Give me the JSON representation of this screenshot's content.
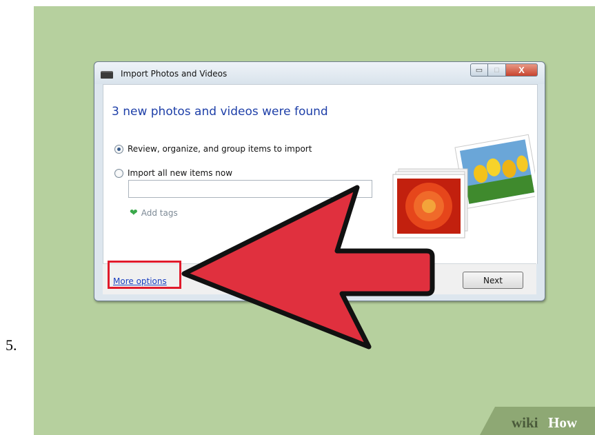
{
  "step_number": "5.",
  "dialog": {
    "title": "Import Photos and Videos",
    "window_buttons": {
      "minimize": "▭",
      "maximize": "□",
      "close": "X"
    },
    "heading": "3 new photos and videos were found",
    "options": [
      {
        "label": "Review, organize, and group items to import",
        "selected": true
      },
      {
        "label": "Import all new items now",
        "selected": false
      }
    ],
    "tags_input": {
      "value": ""
    },
    "add_tags_label": "Add tags",
    "more_options_link": "More options",
    "next_button": "Next"
  },
  "annotation": {
    "arrow_color": "#e0303e",
    "highlight_color": "#e01a2b"
  },
  "watermark": {
    "wiki": "wiki",
    "how": "How"
  }
}
